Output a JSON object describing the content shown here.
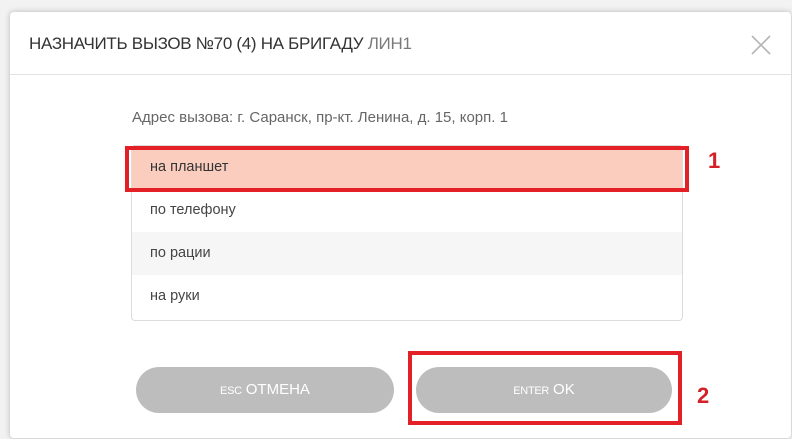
{
  "dialog": {
    "title": "НАЗНАЧИТЬ ВЫЗОВ №70 (4) НА БРИГАДУ",
    "brigade": "ЛИН1",
    "close_icon": "close-icon",
    "address": "Адрес вызова: г. Саранск, пр-кт. Ленина, д. 15, корп. 1",
    "options": [
      {
        "label": "на планшет",
        "selected": true
      },
      {
        "label": "по телефону",
        "selected": false
      },
      {
        "label": "по рации",
        "selected": false
      },
      {
        "label": "на руки",
        "selected": false
      }
    ],
    "cancel_button": {
      "key": "ESC",
      "label": "ОТМЕНА"
    },
    "ok_button": {
      "key": "ENTER",
      "label": "OK"
    }
  },
  "annotations": {
    "marker_1": "1",
    "marker_2": "2",
    "highlight_color": "#e42027"
  },
  "colors": {
    "selected_row": "#fbcdbf",
    "button": "#bdbdbd"
  }
}
